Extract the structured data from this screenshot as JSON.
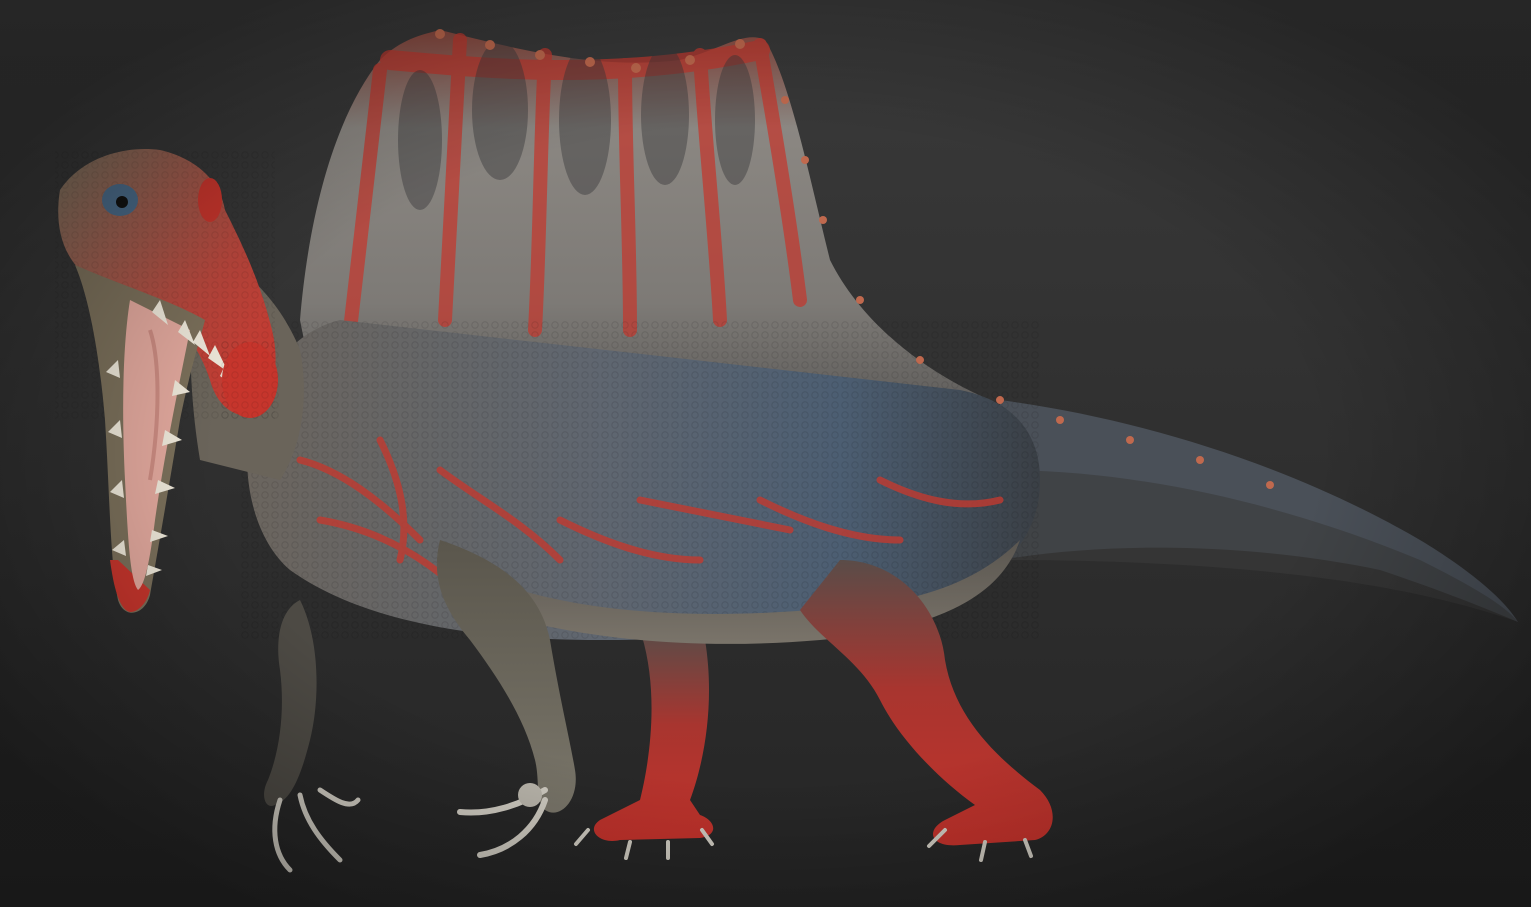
{
  "scene": {
    "subject": "spinosaurus-render",
    "colors": {
      "background_top": "#3a3a3a",
      "background_bottom": "#262626",
      "skin_gray": "#6e6a62",
      "skin_dark": "#3f3b36",
      "skin_blue": "#4c5e72",
      "accent_red": "#c6352c",
      "sail_gray": "#8a8680",
      "mouth_pink": "#e0a79c",
      "teeth": "#ece6d8",
      "claws": "#cfcbc1"
    }
  }
}
